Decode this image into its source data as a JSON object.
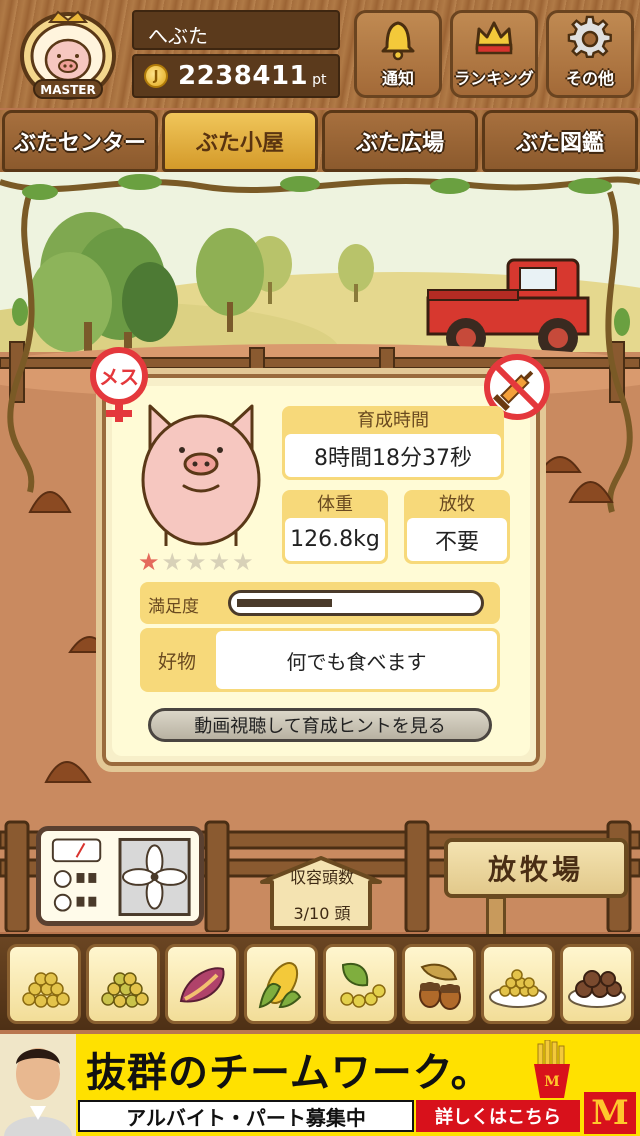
{
  "header": {
    "badge_text": "MASTER",
    "user_name": "へぶた",
    "points": "2238411",
    "points_unit": "pt",
    "coin_symbol": "J",
    "buttons": [
      {
        "label": "通知",
        "icon": "bell-icon"
      },
      {
        "label": "ランキング",
        "icon": "crown-icon"
      },
      {
        "label": "その他",
        "icon": "gear-icon"
      }
    ]
  },
  "tabs": [
    {
      "label": "ぶたセンター",
      "active": false
    },
    {
      "label": "ぶた小屋",
      "active": true
    },
    {
      "label": "ぶた広場",
      "active": false
    },
    {
      "label": "ぶた図鑑",
      "active": false
    }
  ],
  "status": {
    "gender_mark": "メス",
    "gender_icon": "female-icon",
    "medicine_icon": "no-medicine-icon",
    "rating": 1,
    "rating_max": 5,
    "growth_time_label": "育成時間",
    "growth_time_value": "8時間18分37秒",
    "weight_label": "体重",
    "weight_value": "126.8kg",
    "grazing_label": "放牧",
    "grazing_value": "不要",
    "satisfaction_label": "満足度",
    "satisfaction_level": 0.4,
    "favorite_label": "好物",
    "favorite_value": "何でも食べます",
    "hint_button": "動画視聴して育成ヒントを見る"
  },
  "bottom": {
    "capacity_label": "収容頭数",
    "capacity_value": "3/10 頭",
    "ranch_label": "放牧場"
  },
  "foods": [
    {
      "icon": "grain-pile-icon"
    },
    {
      "icon": "grain-mix-icon"
    },
    {
      "icon": "sweet-potato-icon"
    },
    {
      "icon": "corn-icon"
    },
    {
      "icon": "vegetables-icon"
    },
    {
      "icon": "acorn-icon"
    },
    {
      "icon": "grain-dish-icon"
    },
    {
      "icon": "meatballs-icon"
    }
  ],
  "ad": {
    "headline": "抜群のチームワーク。",
    "subline": "アルバイト・パート募集中",
    "cta": "詳しくはこちら",
    "logo": "M",
    "colors": {
      "background": "#ffe100",
      "cta": "#d8111b"
    }
  },
  "colors": {
    "accent_tab": "#f0c65a",
    "wood": "#a46d3c",
    "star_on": "#e46a5c",
    "female_red": "#e4383c"
  }
}
